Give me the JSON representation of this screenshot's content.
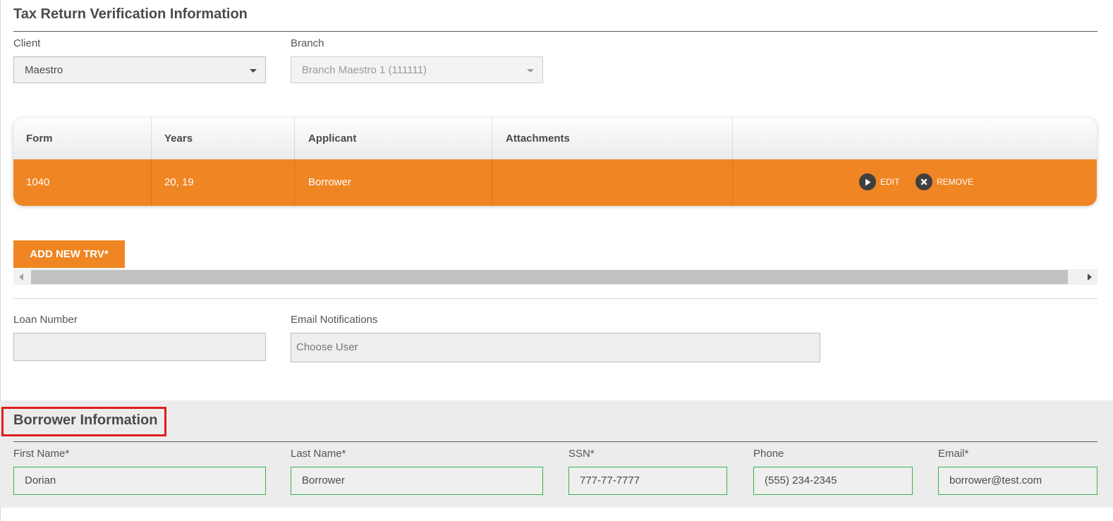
{
  "header": {
    "title": "Tax Return Verification Information"
  },
  "client": {
    "label": "Client",
    "value": "Maestro"
  },
  "branch": {
    "label": "Branch",
    "value": "Branch Maestro 1 (111111)"
  },
  "trv_table": {
    "columns": [
      "Form",
      "Years",
      "Applicant",
      "Attachments"
    ],
    "rows": [
      {
        "form": "1040",
        "years": "20, 19",
        "applicant": "Borrower",
        "attachments": ""
      }
    ],
    "actions": {
      "edit": "EDIT",
      "remove": "REMOVE"
    }
  },
  "add_button": {
    "label": "ADD NEW TRV*"
  },
  "loan_number": {
    "label": "Loan Number",
    "value": ""
  },
  "email_notifications": {
    "label": "Email Notifications",
    "placeholder": "Choose User"
  },
  "borrower": {
    "title": "Borrower Information",
    "first_name": {
      "label": "First Name*",
      "value": "Dorian"
    },
    "last_name": {
      "label": "Last Name*",
      "value": "Borrower"
    },
    "ssn": {
      "label": "SSN*",
      "value": "777-77-7777"
    },
    "phone": {
      "label": "Phone",
      "value": "(555) 234-2345"
    },
    "email": {
      "label": "Email*",
      "value": "borrower@test.com"
    }
  },
  "colors": {
    "accent_orange": "#ef8523",
    "valid_green": "#37b24d",
    "highlight_red": "#e01d1d"
  },
  "icons": {
    "edit": "play-icon",
    "remove": "close-icon"
  }
}
